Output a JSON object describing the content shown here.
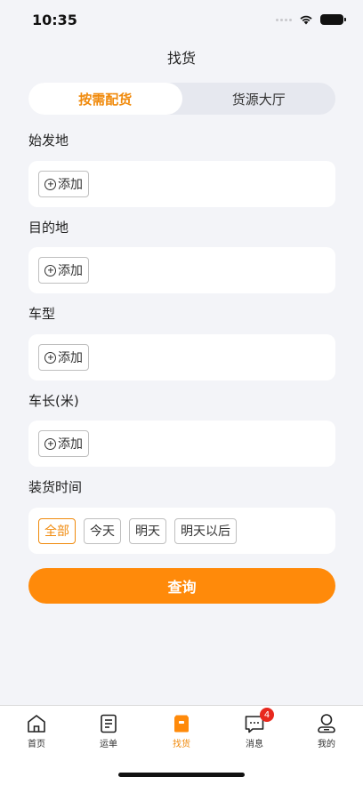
{
  "status": {
    "time": "10:35"
  },
  "nav": {
    "title": "找货"
  },
  "segment": {
    "tabs": [
      "按需配货",
      "货源大厅"
    ],
    "active_index": 0
  },
  "fields": [
    {
      "label": "始发地",
      "button": "添加"
    },
    {
      "label": "目的地",
      "button": "添加"
    },
    {
      "label": "车型",
      "button": "添加"
    },
    {
      "label": "车长(米)",
      "button": "添加"
    }
  ],
  "load_time": {
    "label": "装货时间",
    "options": [
      "全部",
      "今天",
      "明天",
      "明天以后"
    ],
    "selected_index": 0
  },
  "query_button": "查询",
  "tabbar": {
    "items": [
      {
        "label": "首页",
        "icon": "home-icon"
      },
      {
        "label": "运单",
        "icon": "waybill-icon"
      },
      {
        "label": "找货",
        "icon": "box-icon"
      },
      {
        "label": "消息",
        "icon": "message-icon",
        "badge": "4"
      },
      {
        "label": "我的",
        "icon": "profile-icon"
      }
    ],
    "active_index": 2
  },
  "colors": {
    "accent": "#ff8a0a",
    "accent_text": "#f08a0c",
    "badge": "#e8281e"
  }
}
